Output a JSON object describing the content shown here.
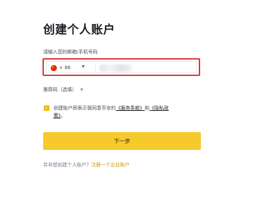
{
  "page": {
    "title": "创建个人账户"
  },
  "phone": {
    "label": "请输入您的邮箱/手机号码",
    "country_code": "+ 86",
    "caret": "▼",
    "flag_icon": "china-flag-icon"
  },
  "referral": {
    "label": "推荐码（选填）",
    "caret": "▼"
  },
  "terms": {
    "checkbox_mark": "✓",
    "prefix": "创建账户即表示我同意币安的",
    "service_link": "《服务条款》",
    "middle": "和",
    "privacy_link": "《隐私政策》",
    "suffix": "。"
  },
  "actions": {
    "next_label": "下一步"
  },
  "footer": {
    "prefix": "并非想创建个人账户？",
    "link": "注册一个企业账户"
  },
  "colors": {
    "accent": "#f6c92d",
    "highlight_border": "#d9363e",
    "link": "#c99400"
  }
}
